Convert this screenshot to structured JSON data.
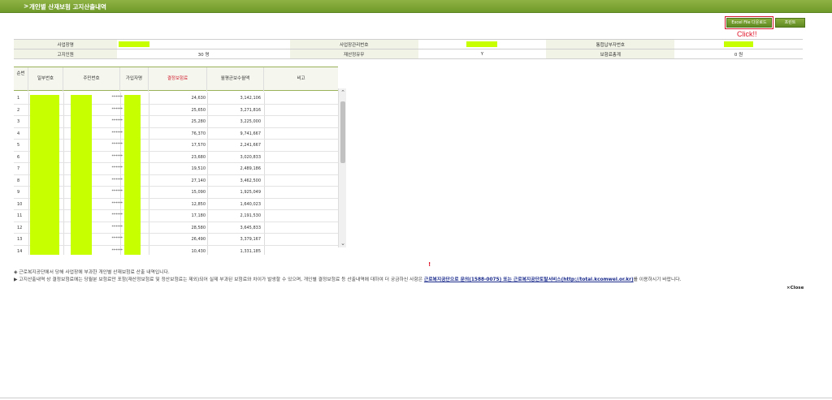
{
  "window": {
    "title": "개인별 산재보험 고지산출내역",
    "title_icon": "chevron-right-icon"
  },
  "toolbar": {
    "excel_label": "Excel File 다운로드",
    "print_label": "프린트",
    "click_note": "Click!!"
  },
  "info": {
    "workplace_name_label": "사업장명",
    "workplace_mgmt_no_label": "사업장관리번호",
    "integrated_payer_no_label": "통합납부자번호",
    "notice_persons_label": "고지인원",
    "notice_persons_value": "30 명",
    "recalc_label": "재산정유무",
    "recalc_value": "Y",
    "total_premium_label": "보험료총계",
    "total_premium_value": "0 원"
  },
  "grid": {
    "headers": [
      "순번",
      "일부번호",
      "주민번호",
      "가입자명",
      "결정보험료",
      "월평균보수월액",
      "비고"
    ],
    "rows": [
      {
        "no": "1",
        "rrn": "******",
        "amount": "24,630",
        "avg": "3,142,106"
      },
      {
        "no": "2",
        "rrn": "******",
        "amount": "25,650",
        "avg": "3,271,816"
      },
      {
        "no": "3",
        "rrn": "******",
        "amount": "25,280",
        "avg": "3,225,000"
      },
      {
        "no": "4",
        "rrn": "******",
        "amount": "76,370",
        "avg": "9,741,667"
      },
      {
        "no": "5",
        "rrn": "******",
        "amount": "17,570",
        "avg": "2,241,667"
      },
      {
        "no": "6",
        "rrn": "******",
        "amount": "23,680",
        "avg": "3,020,833"
      },
      {
        "no": "7",
        "rrn": "******",
        "amount": "19,510",
        "avg": "2,489,186"
      },
      {
        "no": "8",
        "rrn": "******",
        "amount": "27,140",
        "avg": "3,462,500"
      },
      {
        "no": "9",
        "rrn": "******",
        "amount": "15,090",
        "avg": "1,925,049"
      },
      {
        "no": "10",
        "rrn": "******",
        "amount": "12,850",
        "avg": "1,640,023"
      },
      {
        "no": "11",
        "rrn": "******",
        "amount": "17,180",
        "avg": "2,191,530"
      },
      {
        "no": "12",
        "rrn": "******",
        "amount": "28,580",
        "avg": "3,645,833"
      },
      {
        "no": "13",
        "rrn": "******",
        "amount": "26,490",
        "avg": "3,379,167"
      },
      {
        "no": "14",
        "rrn": "******",
        "amount": "10,430",
        "avg": "1,331,185"
      }
    ]
  },
  "footer": {
    "bang": "!",
    "note1": "◈ 근로복지공단에서 당해 사업장에 부과한 개인별 산재보험료 산출 내역입니다.",
    "note2_pre": "▶ 고지산출내역 상 결정보험료에는 당월분 보험료만 포함(재산정보험료 및 정산보험료는 제외)되어 실제 부과된 보험료와 차이가 발생할 수 있으며, 개인별 결정보험료 등 산출내역에 대하여 더 궁금하신 사항은 ",
    "note2_link": "근로복지공단으로 문의(1588-0075) 또는 근로복지공단토탈서비스(http://total.kcomwel.or.kr)",
    "note2_post": "를 이용하시기 바랍니다.",
    "close_label": "Close",
    "close_icon": "close-icon"
  },
  "colors": {
    "accent": "#6f9a2a",
    "mask": "#c8ff00",
    "alert": "#e0162b"
  }
}
